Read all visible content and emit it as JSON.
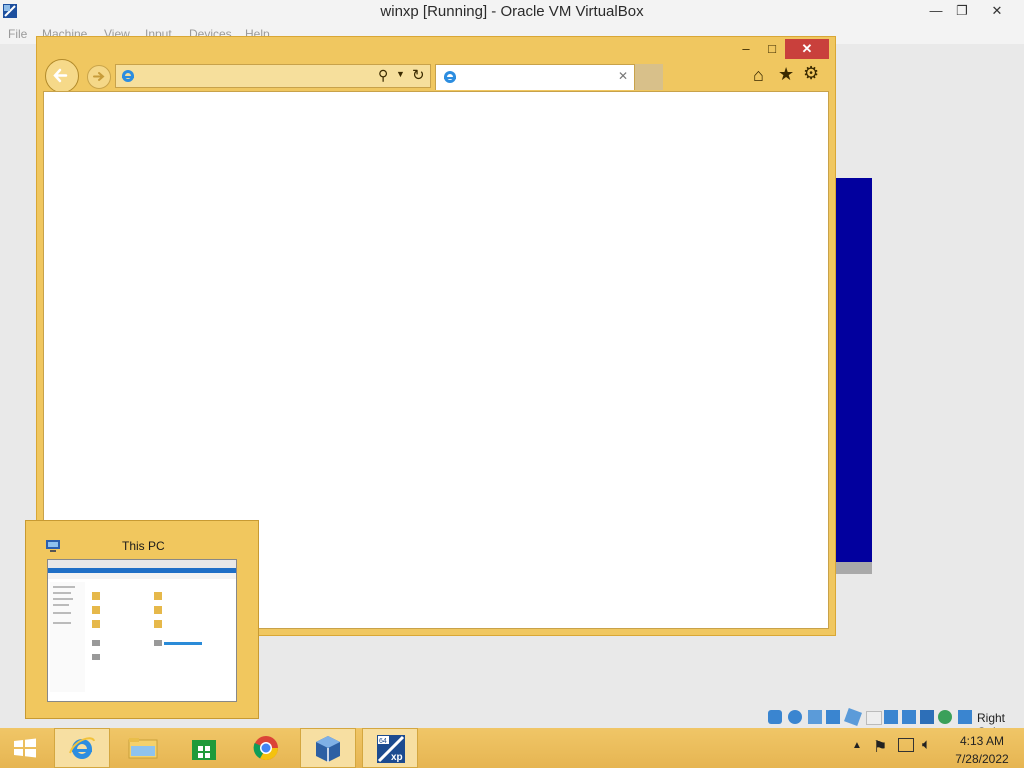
{
  "vbox": {
    "title": "winxp  [Running] - Oracle VM VirtualBox",
    "menu": [
      "File",
      "Machine",
      "View",
      "Input",
      "Devices",
      "Help"
    ],
    "host_key": "Right Ctrl"
  },
  "ie": {
    "window": "Internet Explorer",
    "address_value": "",
    "tab_title": ""
  },
  "preview": {
    "title": "This PC"
  },
  "taskbar": {
    "items": [
      "Internet Explorer",
      "File Explorer",
      "Store",
      "Google Chrome",
      "Oracle VM VirtualBox",
      "winxp"
    ],
    "clock_time": "4:13 AM",
    "clock_date": "7/28/2022"
  },
  "colors": {
    "accent": "#f0c760",
    "xp_blue": "#02009e",
    "close_red": "#c9403c"
  },
  "icons": {
    "app": "virtualbox-icon",
    "ie": "internet-explorer-icon",
    "search": "search-icon",
    "refresh": "refresh-icon",
    "home": "home-icon",
    "favorites": "star-icon",
    "tools": "gear-icon"
  }
}
